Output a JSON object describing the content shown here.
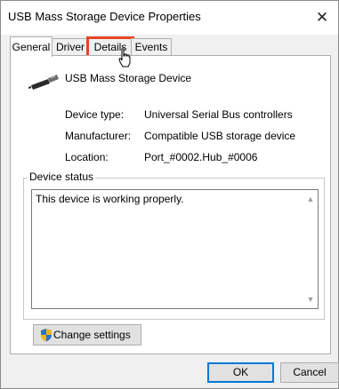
{
  "window": {
    "title": "USB Mass Storage Device Properties",
    "close_glyph": "✕"
  },
  "tabs": [
    {
      "label": "General",
      "active": true
    },
    {
      "label": "Driver",
      "active": false
    },
    {
      "label": "Details",
      "active": false,
      "highlighted": true
    },
    {
      "label": "Events",
      "active": false
    }
  ],
  "device": {
    "name": "USB Mass Storage Device",
    "icon": "usb-plug-icon"
  },
  "properties": [
    {
      "label": "Device type:",
      "value": "Universal Serial Bus controllers"
    },
    {
      "label": "Manufacturer:",
      "value": "Compatible USB storage device"
    },
    {
      "label": "Location:",
      "value": "Port_#0002.Hub_#0006"
    }
  ],
  "device_status": {
    "legend": "Device status",
    "text": "This device is working properly."
  },
  "change_settings": {
    "label": "Change settings",
    "icon": "uac-shield-icon"
  },
  "buttons": {
    "ok": "OK",
    "cancel": "Cancel"
  },
  "colors": {
    "highlight": "#e64524",
    "default_button_border": "#0078d7"
  }
}
